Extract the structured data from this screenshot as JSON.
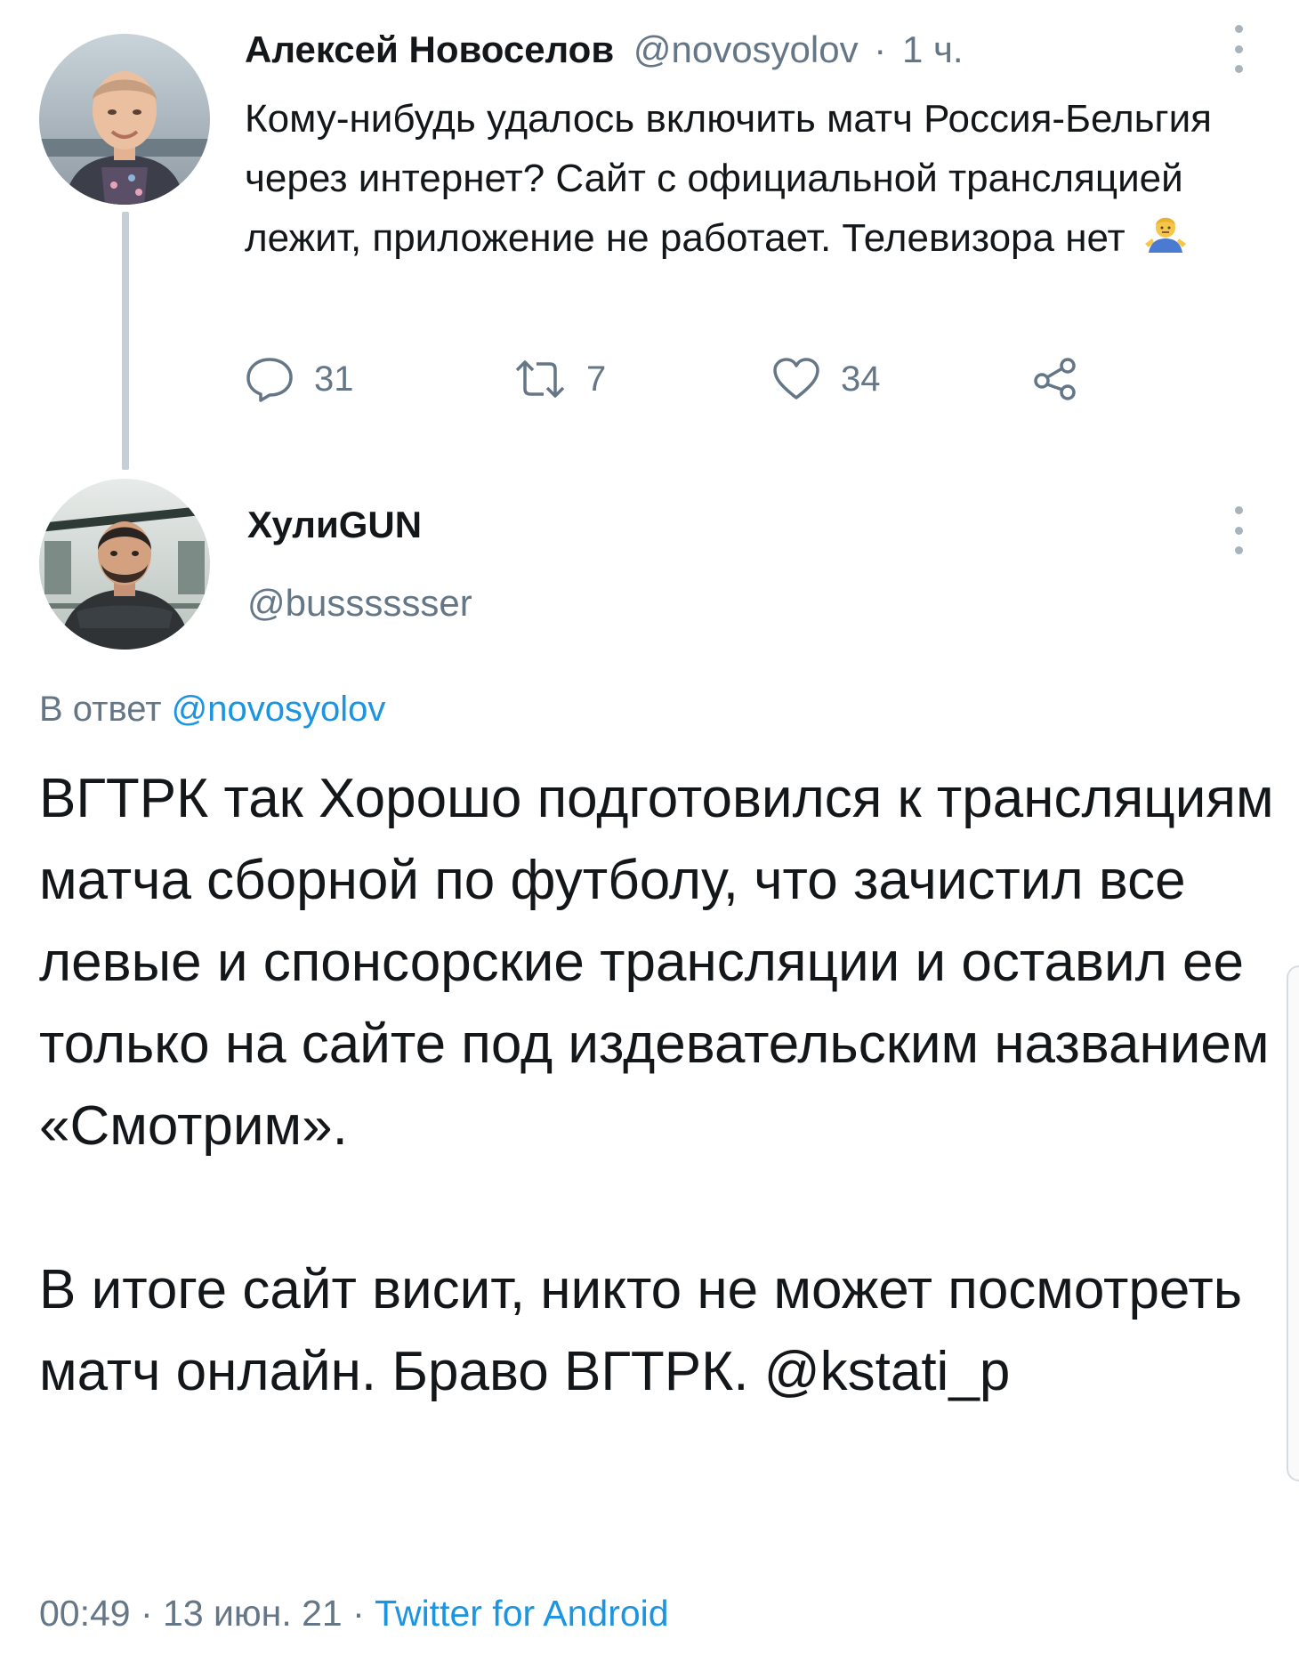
{
  "parent_tweet": {
    "author_name": "Алексей Новоселов",
    "author_handle": "@novosyolov",
    "time_separator": "·",
    "time": "1 ч.",
    "text": "Кому-нибудь удалось включить матч Россия-Бельгия через интернет? Сайт с официальной трансляцией лежит, приложение не работает. Телевизора нет",
    "emoji": "man-shrugging-emoji",
    "actions": {
      "replies": "31",
      "retweets": "7",
      "likes": "34"
    }
  },
  "reply_tweet": {
    "author_name": "ХулиGUN",
    "author_handle": "@busssssser",
    "reply_prefix": "В ответ",
    "reply_to_handle": "@novosyolov",
    "paragraph1": "ВГТРК так Хорошо подготовился к трансляциям матча сборной  по футболу, что зачистил все левые и спонсорские трансляции и оставил ее только на сайте под издевательским названием «Смотрим».",
    "paragraph2": "В итоге сайт висит, никто не может посмотреть матч онлайн. Браво ВГТРК. @kstati_p",
    "timestamp": "00:49 · 13 июн. 21 ·",
    "source": "Twitter for Android"
  },
  "colors": {
    "text": "#14171a",
    "secondary": "#657786",
    "link": "#1b95e0",
    "thread_line": "#c4cfd6"
  }
}
